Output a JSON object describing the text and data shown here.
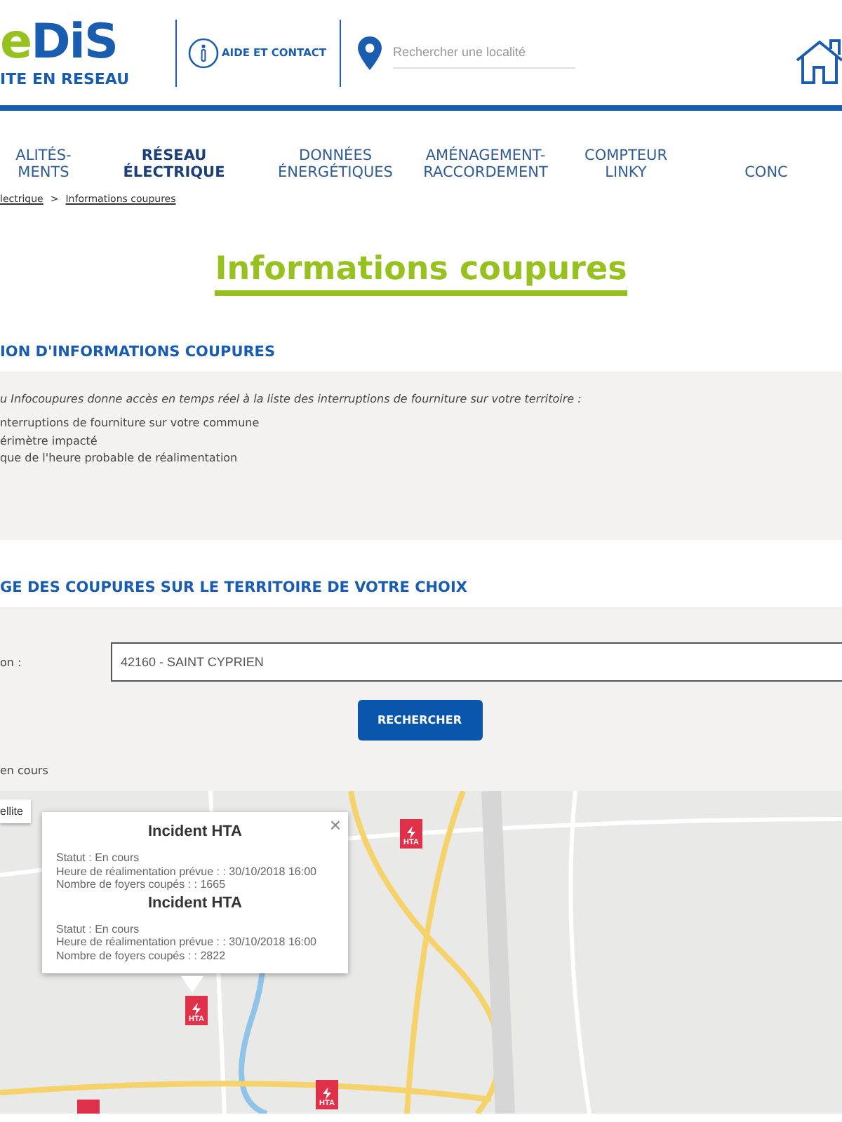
{
  "header": {
    "logo_accent": "e",
    "logo_main": "DiS",
    "logo_tagline": "ITE EN RESEAU",
    "help_link": "AIDE ET CONTACT",
    "search": {
      "placeholder": "Rechercher une localité"
    }
  },
  "nav": [
    {
      "lines": [
        "ALITÉS-",
        "MENTS"
      ],
      "selected": false
    },
    {
      "lines": [
        "RÉSEAU",
        "ÉLECTRIQUE"
      ],
      "selected": true
    },
    {
      "lines": [
        "DONNÉES",
        "ÉNERGÉTIQUES"
      ],
      "selected": false
    },
    {
      "lines": [
        "AMÉNAGEMENT-",
        "RACCORDEMENT"
      ],
      "selected": false
    },
    {
      "lines": [
        "COMPTEUR",
        "LINKY"
      ],
      "selected": false
    },
    {
      "lines": [
        "CONC"
      ],
      "selected": false
    }
  ],
  "breadcrumb": [
    "lectrique",
    "Informations coupures"
  ],
  "breadcrumb_separator": ">",
  "title": "Informations coupures",
  "info_section": {
    "heading": "ION D'INFORMATIONS COUPURES",
    "intro": "u Infocoupures donne accès en temps réel à la liste des interruptions de fourniture sur votre territoire :",
    "items": [
      "nterruptions de fourniture sur votre commune",
      "érimètre impacté",
      "que de l'heure probable de réalimentation"
    ]
  },
  "search_section": {
    "heading": "GE DES COUPURES SUR LE TERRITOIRE DE VOTRE CHOIX",
    "label": "on :",
    "value": "42160 - SAINT CYPRIEN",
    "button": "RECHERCHER",
    "status": "en cours"
  },
  "map": {
    "type_control": "ellite",
    "popup": {
      "close": "×",
      "incidents": [
        {
          "title": "Incident HTA",
          "lines": [
            "Statut : En cours",
            "Heure de réalimentation prévue : : 30/10/2018 16:00",
            "Nombre de foyers coupés : : 1665"
          ]
        },
        {
          "title": "Incident HTA",
          "lines": [
            "Statut : En cours",
            "Heure de réalimentation prévue : : 30/10/2018 16:00",
            "Nombre de foyers coupés : : 2822"
          ]
        }
      ]
    },
    "markers": [
      {
        "kind": "labelled",
        "label": "HTA"
      },
      {
        "kind": "labelled",
        "label": "HTA"
      },
      {
        "kind": "labelled",
        "label": "HTA"
      },
      {
        "kind": "cut"
      }
    ]
  }
}
